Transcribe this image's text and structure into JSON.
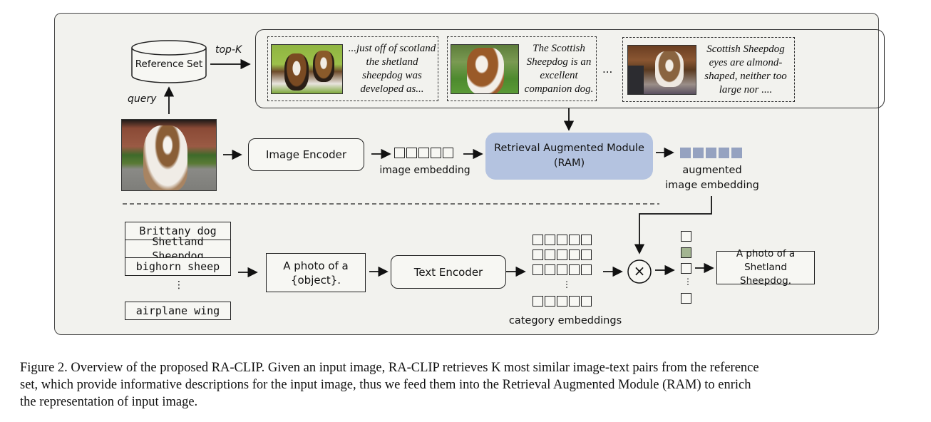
{
  "diagram": {
    "reference_set": {
      "label": "Reference Set"
    },
    "edge_labels": {
      "top_k": "top-K",
      "query": "query"
    },
    "retrieved_pairs": [
      {
        "image": "two-shetland-sheepdogs-photo",
        "text": "...just off of scotland the shetland sheepdog was developed as..."
      },
      {
        "image": "sheepdog-standing-in-park-photo",
        "text": "The Scottish Sheepdog is an excellent companion dog."
      },
      {
        "image": "sheepdog-lying-indoors-photo",
        "text": "Scottish Sheepdog eyes are almond-shaped, neither too large nor ...."
      }
    ],
    "ellipsis": "...",
    "input_image": "input-sheltie-photo",
    "image_encoder": {
      "label": "Image Encoder"
    },
    "image_embedding": {
      "label": "image embedding",
      "cells": 5
    },
    "ram": {
      "line1": "Retrieval Augmented Module",
      "line2": "(RAM)",
      "color": "#b4c3e0"
    },
    "augmented_embedding": {
      "line1": "augmented",
      "line2": "image embedding",
      "cells": 5,
      "color": "#95a2c0"
    },
    "categories": [
      "Brittany dog",
      "Shetland Sheepdog",
      "bighorn sheep",
      "airplane wing"
    ],
    "vertical_ellipsis": "⋮",
    "prompt": {
      "line1": "A photo of a",
      "line2": "{object}."
    },
    "text_encoder": {
      "label": "Text Encoder"
    },
    "category_embeddings": {
      "label": "category embeddings",
      "rows": 4,
      "cells": 5
    },
    "multiply": {
      "symbol": "×"
    },
    "scores": {
      "count": 4,
      "highlight_index": 1,
      "highlight_color": "#a3b591"
    },
    "output": {
      "line1": "A photo of a",
      "line2": "Shetland Sheepdog."
    }
  },
  "caption": {
    "line1": "Figure 2. Overview of the proposed RA-CLIP. Given an input image, RA-CLIP retrieves K most similar image-text pairs from the reference",
    "line2": "set, which provide informative descriptions for the input image, thus we feed them into the Retrieval Augmented Module (RAM) to enrich",
    "line3": "the representation of input image."
  }
}
